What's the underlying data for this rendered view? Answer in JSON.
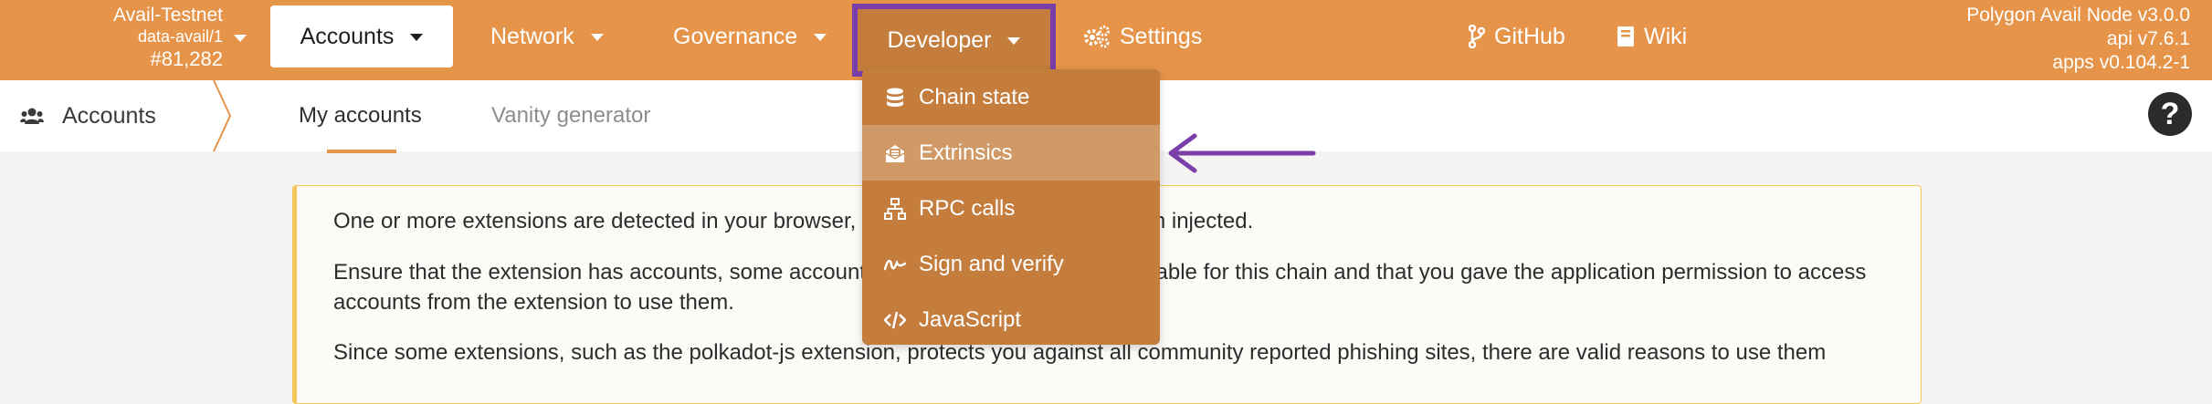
{
  "header": {
    "chain": {
      "name": "Avail-Testnet",
      "spec": "data-avail/1",
      "block": "#81,282"
    },
    "nav": {
      "accounts": "Accounts",
      "network": "Network",
      "governance": "Governance",
      "developer": "Developer",
      "settings": "Settings",
      "github": "GitHub",
      "wiki": "Wiki"
    },
    "node_info": {
      "node": "Polygon Avail Node v3.0.0",
      "api": "api v7.6.1",
      "apps": "apps v0.104.2-1"
    },
    "accent_color": "#e6944a",
    "highlight_border_color": "#7a3ea8"
  },
  "subheader": {
    "section": "Accounts",
    "tabs": [
      "My accounts",
      "Vanity generator"
    ],
    "active_tab": "My accounts",
    "help_icon": "?"
  },
  "developer_menu": {
    "items": [
      {
        "label": "Chain state",
        "icon": "database-icon"
      },
      {
        "label": "Extrinsics",
        "icon": "envelope-open-icon",
        "highlighted": true
      },
      {
        "label": "RPC calls",
        "icon": "network-wired-icon"
      },
      {
        "label": "Sign and verify",
        "icon": "signature-icon"
      },
      {
        "label": "JavaScript",
        "icon": "code-icon"
      }
    ]
  },
  "notice": {
    "p1": "One or more extensions are detected in your browser, however no accounts has been injected.",
    "p2": "Ensure that the extension has accounts, some accounts are visible globally and available for this chain and that you gave the application permission to access accounts from the extension to use them.",
    "p3": "Since some extensions, such as the polkadot-js extension, protects you against all community reported phishing sites, there are valid reasons to use them"
  },
  "annotation": {
    "arrow_color": "#7a3ea8"
  }
}
